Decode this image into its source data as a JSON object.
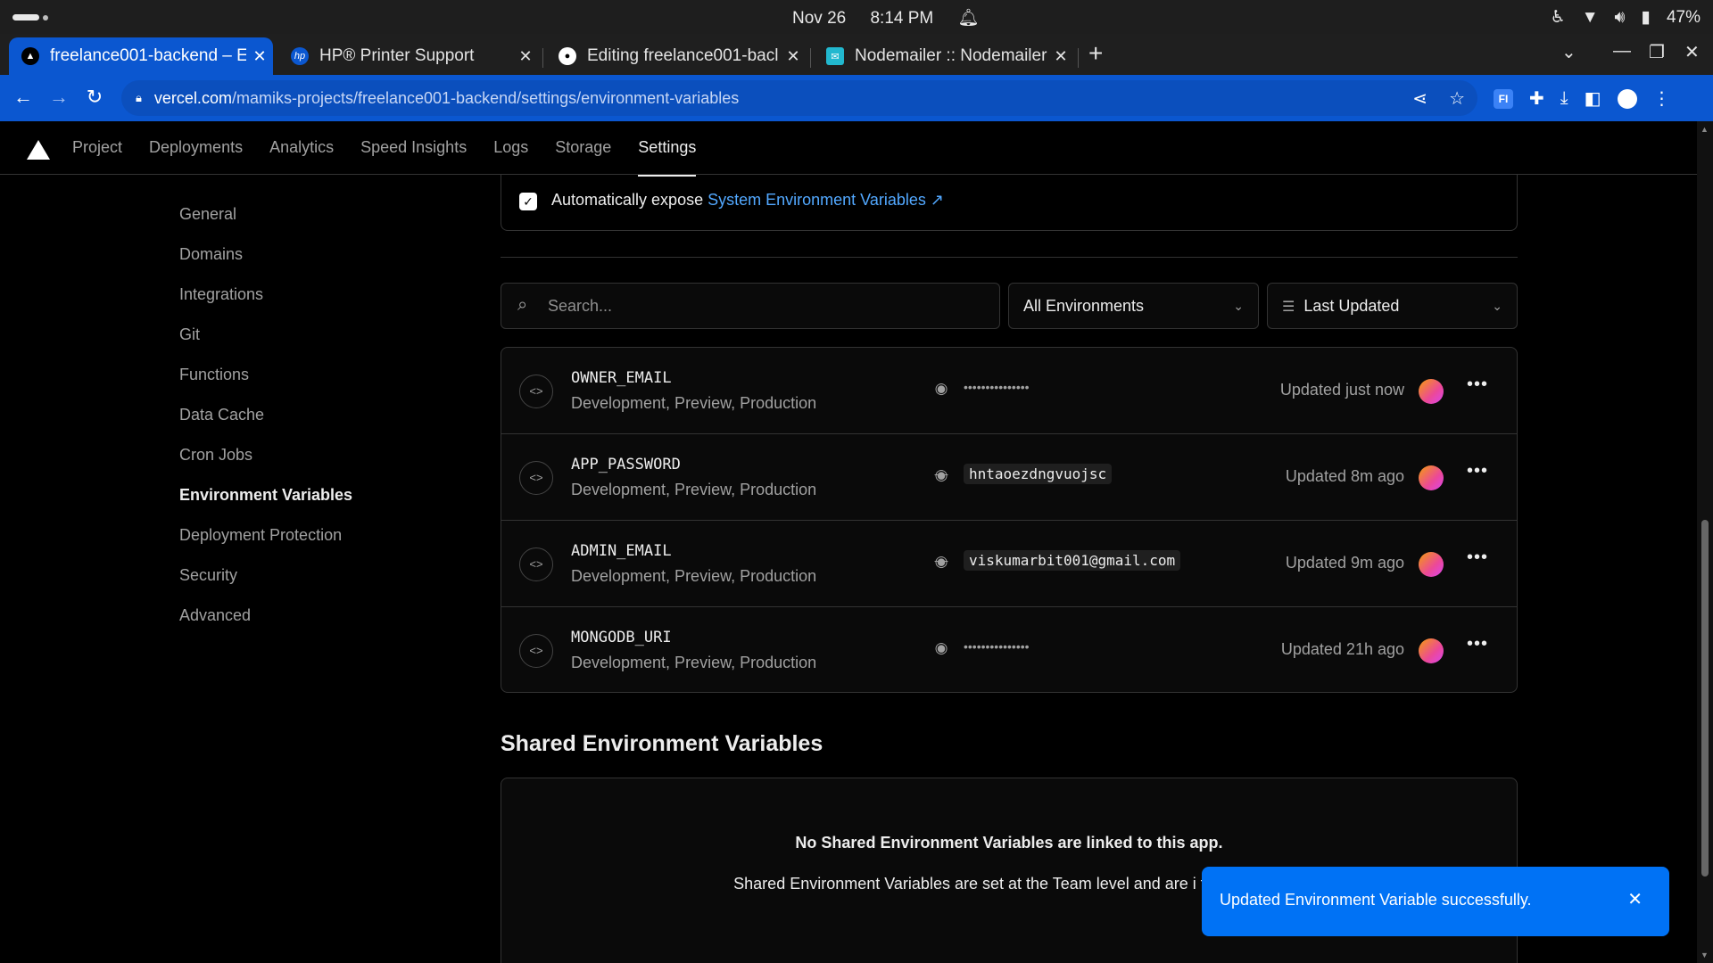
{
  "status_bar": {
    "date": "Nov 26",
    "time": "8:14 PM",
    "battery": "47%"
  },
  "browser": {
    "tabs": [
      {
        "title": "freelance001-backend – E",
        "favicon": "vercel-icon",
        "active": true
      },
      {
        "title": "HP® Printer Support",
        "favicon": "hp-icon",
        "active": false
      },
      {
        "title": "Editing freelance001-bacl",
        "favicon": "github-icon",
        "active": false
      },
      {
        "title": "Nodemailer :: Nodemailer",
        "favicon": "nodemailer-icon",
        "active": false
      }
    ],
    "url_domain": "vercel.com",
    "url_path": "/mamiks-projects/freelance001-backend/settings/environment-variables",
    "extension_label": "FI"
  },
  "vercel_nav": [
    "Project",
    "Deployments",
    "Analytics",
    "Speed Insights",
    "Logs",
    "Storage",
    "Settings"
  ],
  "vercel_nav_active": "Settings",
  "sidebar": {
    "items": [
      "General",
      "Domains",
      "Integrations",
      "Git",
      "Functions",
      "Data Cache",
      "Cron Jobs",
      "Environment Variables",
      "Deployment Protection",
      "Security",
      "Advanced"
    ],
    "active": "Environment Variables"
  },
  "expose": {
    "prefix": "Automatically expose",
    "link": "System Environment Variables",
    "checked": true
  },
  "filters": {
    "search_placeholder": "Search...",
    "environment": "All Environments",
    "sort": "Last Updated"
  },
  "variables": [
    {
      "name": "OWNER_EMAIL",
      "envs": "Development, Preview, Production",
      "visible": false,
      "value": "•••••••••••••••",
      "updated": "Updated just now"
    },
    {
      "name": "APP_PASSWORD",
      "envs": "Development, Preview, Production",
      "visible": true,
      "value": "hntaoezdngvuojsc",
      "updated": "Updated 8m ago"
    },
    {
      "name": "ADMIN_EMAIL",
      "envs": "Development, Preview, Production",
      "visible": true,
      "value": "viskumarbit001@gmail.com",
      "updated": "Updated 9m ago"
    },
    {
      "name": "MONGODB_URI",
      "envs": "Development, Preview, Production",
      "visible": false,
      "value": "•••••••••••••••",
      "updated": "Updated 21h ago"
    }
  ],
  "shared": {
    "title": "Shared Environment Variables",
    "empty_heading": "No Shared Environment Variables are linked to this app.",
    "empty_text": "Shared Environment Variables are set at the Team level and are i this Project."
  },
  "toast": {
    "message": "Updated Environment Variable successfully."
  }
}
